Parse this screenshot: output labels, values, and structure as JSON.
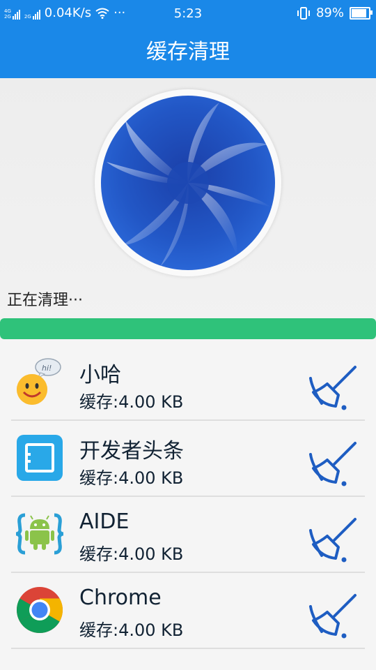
{
  "status_bar": {
    "network_label": "4G 2G",
    "speed": "0.04K/s",
    "dots": "···",
    "time": "5:23",
    "battery": "89%",
    "battery_level": 0.89
  },
  "app_bar": {
    "title": "缓存清理"
  },
  "cleaning": {
    "status_text": "正在清理···",
    "progress": 1.0
  },
  "apps": [
    {
      "name": "小哈",
      "cache": "缓存:4.00 KB",
      "icon": "smiley-hi-icon"
    },
    {
      "name": "开发者头条",
      "cache": "缓存:4.00 KB",
      "icon": "developer-headlines-icon"
    },
    {
      "name": "AIDE",
      "cache": "缓存:4.00 KB",
      "icon": "android-aide-icon"
    },
    {
      "name": "Chrome",
      "cache": "缓存:4.00 KB",
      "icon": "chrome-icon"
    }
  ],
  "colors": {
    "primary": "#1a88e8",
    "progress": "#2fc27a",
    "broom": "#1e5dc2"
  }
}
